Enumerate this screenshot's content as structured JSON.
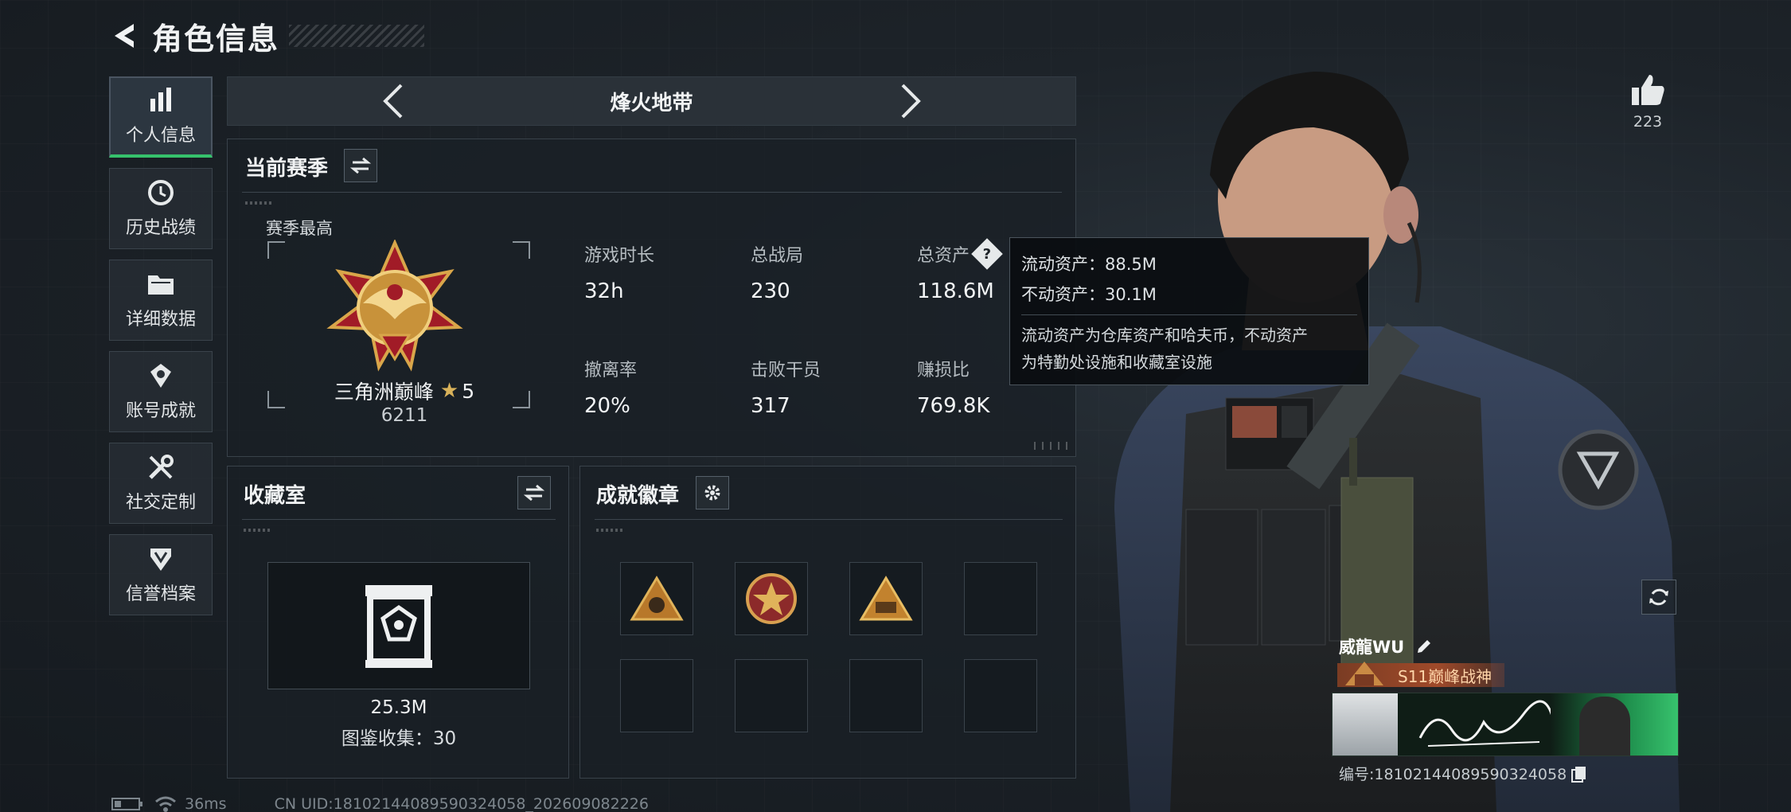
{
  "header": {
    "title": "角色信息"
  },
  "sidebar": {
    "items": [
      {
        "label": "个人信息",
        "active": true
      },
      {
        "label": "历史战绩"
      },
      {
        "label": "详细数据"
      },
      {
        "label": "账号成就"
      },
      {
        "label": "社交定制"
      },
      {
        "label": "信誉档案"
      }
    ]
  },
  "mode": {
    "title": "烽火地带"
  },
  "season": {
    "title": "当前赛季",
    "best_label": "赛季最高",
    "rank_name": "三角洲巅峰",
    "rank_stars": "5",
    "rank_score": "6211",
    "stats": [
      {
        "label": "游戏时长",
        "value": "32h"
      },
      {
        "label": "总战局",
        "value": "230"
      },
      {
        "label": "总资产",
        "value": "118.6M"
      },
      {
        "label": "撤离率",
        "value": "20%"
      },
      {
        "label": "击败干员",
        "value": "317"
      },
      {
        "label": "赚损比",
        "value": "769.8K"
      }
    ]
  },
  "tooltip": {
    "liquid": "流动资产：88.5M",
    "fixed": "不动资产：30.1M",
    "desc_line1": "流动资产为仓库资产和哈夫币，不动资产",
    "desc_line2": "为特勤处设施和收藏室设施"
  },
  "collection": {
    "title": "收藏室",
    "value": "25.3M",
    "collected": "图鉴收集：30"
  },
  "achievements": {
    "title": "成就徽章"
  },
  "profile": {
    "likes": "223",
    "name": "威龍WU",
    "badge_title": "S11巅峰战神",
    "id_text": "编号:1810214408959032405​8"
  },
  "footer": {
    "ping": "36ms",
    "uid": "CN UID:18102144089590324058_202609082226"
  },
  "colors": {
    "accent": "#36c26c",
    "panel_border": "#39424a"
  }
}
